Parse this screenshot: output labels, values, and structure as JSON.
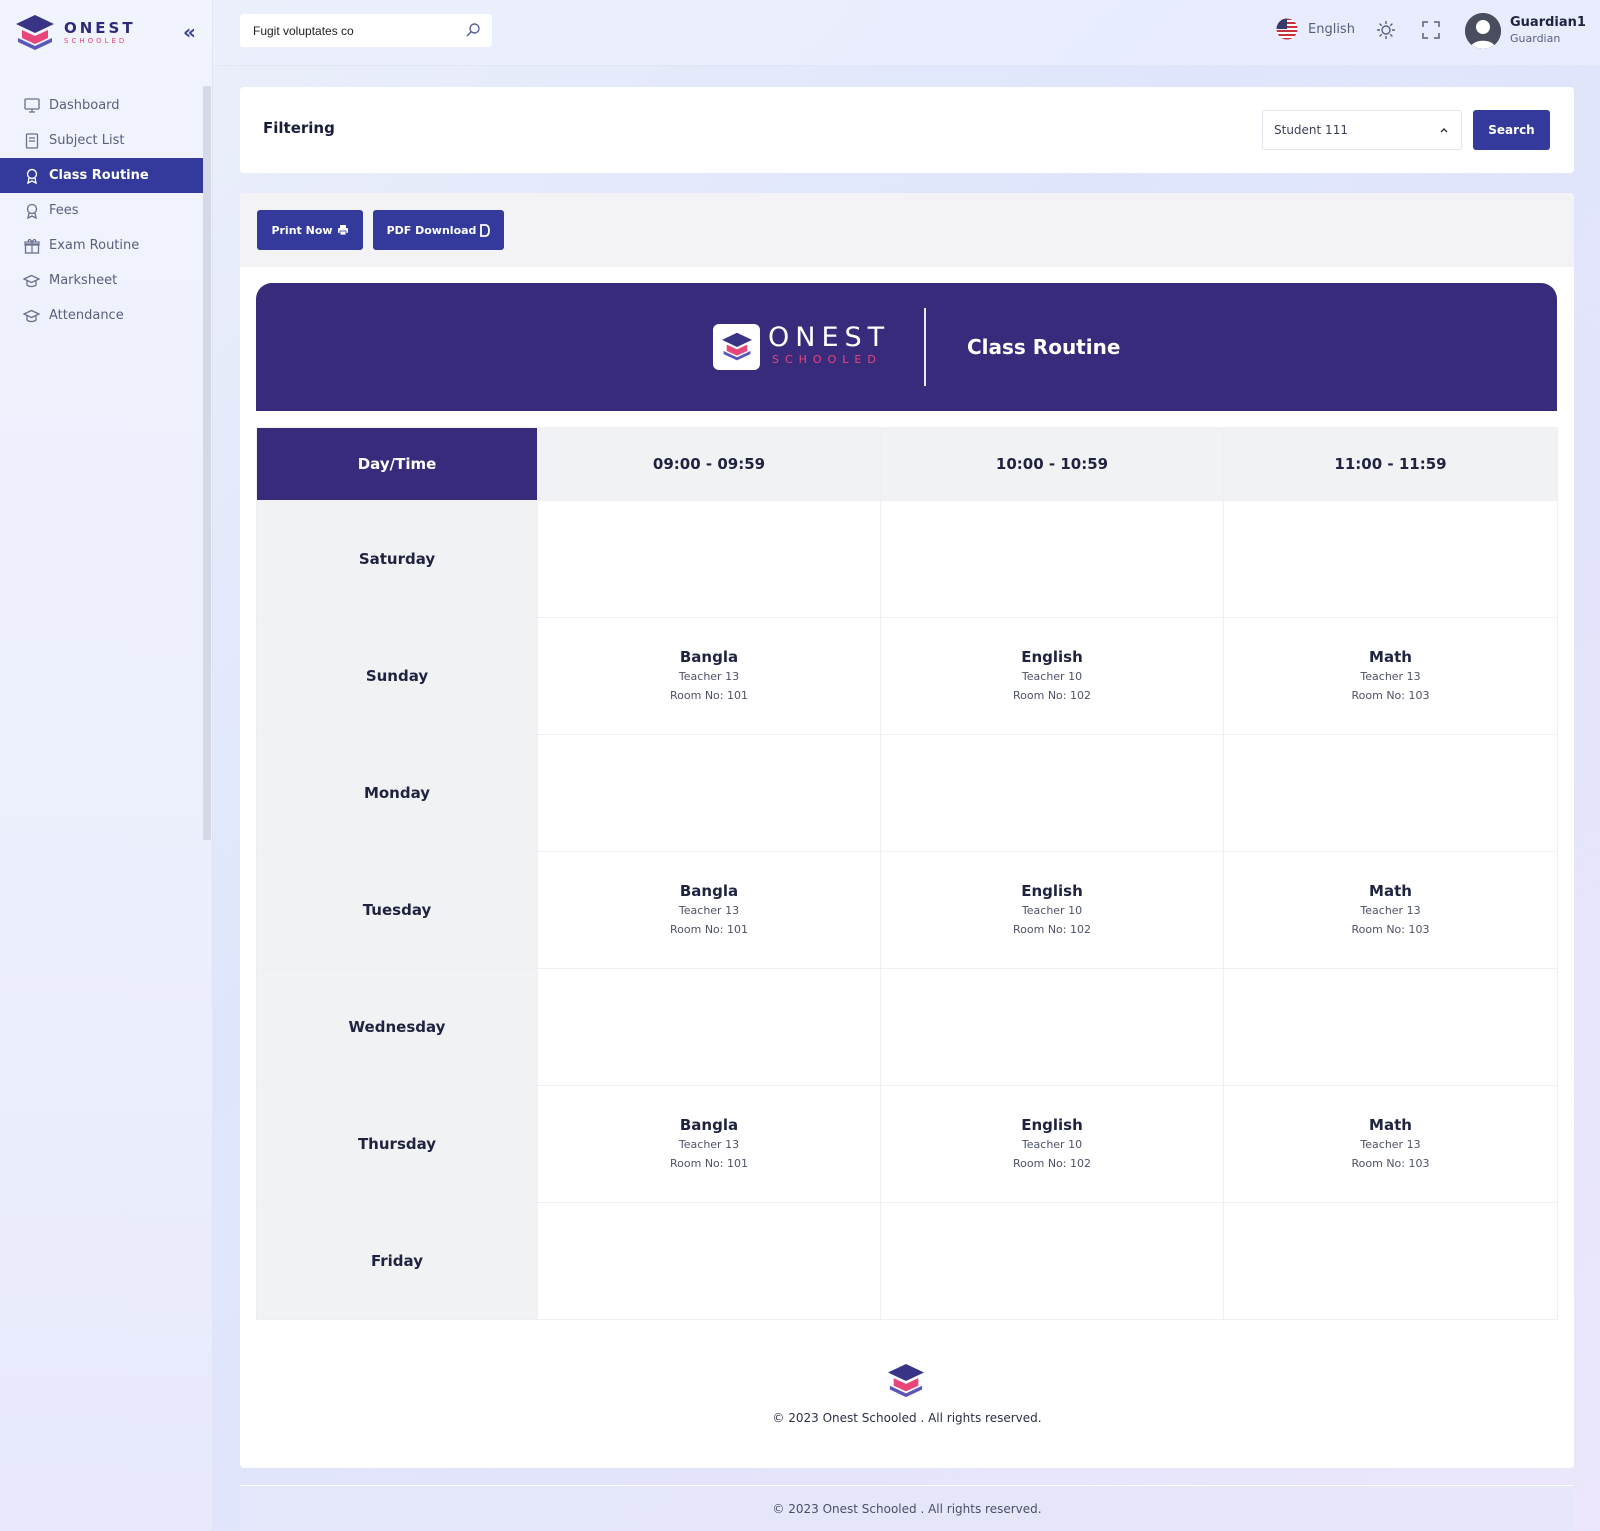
{
  "brand": {
    "name": "ONEST",
    "sub": "SCHOOLED"
  },
  "sidebar": {
    "items": [
      {
        "label": "Dashboard",
        "icon": "monitor-icon"
      },
      {
        "label": "Subject List",
        "icon": "book-icon"
      },
      {
        "label": "Class Routine",
        "icon": "award-icon",
        "active": true
      },
      {
        "label": "Fees",
        "icon": "award-icon"
      },
      {
        "label": "Exam Routine",
        "icon": "gift-icon"
      },
      {
        "label": "Marksheet",
        "icon": "graduation-cap-icon"
      },
      {
        "label": "Attendance",
        "icon": "graduation-cap-icon"
      }
    ]
  },
  "header": {
    "search_value": "Fugit voluptates co",
    "language": "English",
    "user_name": "Guardian1",
    "user_role": "Guardian"
  },
  "filter": {
    "title": "Filtering",
    "student_selected": "Student 111",
    "search_label": "Search"
  },
  "actions": {
    "print_label": "Print Now",
    "pdf_label": "PDF Download"
  },
  "routine": {
    "banner_title": "Class Routine",
    "corner_label": "Day/Time",
    "time_slots": [
      "09:00 - 09:59",
      "10:00 - 10:59",
      "11:00 - 11:59"
    ],
    "days": [
      {
        "day": "Saturday",
        "slots": [
          null,
          null,
          null
        ]
      },
      {
        "day": "Sunday",
        "slots": [
          {
            "subject": "Bangla",
            "teacher": "Teacher 13",
            "room": "Room No: 101"
          },
          {
            "subject": "English",
            "teacher": "Teacher 10",
            "room": "Room No: 102"
          },
          {
            "subject": "Math",
            "teacher": "Teacher 13",
            "room": "Room No: 103"
          }
        ]
      },
      {
        "day": "Monday",
        "slots": [
          null,
          null,
          null
        ]
      },
      {
        "day": "Tuesday",
        "slots": [
          {
            "subject": "Bangla",
            "teacher": "Teacher 13",
            "room": "Room No: 101"
          },
          {
            "subject": "English",
            "teacher": "Teacher 10",
            "room": "Room No: 102"
          },
          {
            "subject": "Math",
            "teacher": "Teacher 13",
            "room": "Room No: 103"
          }
        ]
      },
      {
        "day": "Wednesday",
        "slots": [
          null,
          null,
          null
        ]
      },
      {
        "day": "Thursday",
        "slots": [
          {
            "subject": "Bangla",
            "teacher": "Teacher 13",
            "room": "Room No: 101"
          },
          {
            "subject": "English",
            "teacher": "Teacher 10",
            "room": "Room No: 102"
          },
          {
            "subject": "Math",
            "teacher": "Teacher 13",
            "room": "Room No: 103"
          }
        ]
      },
      {
        "day": "Friday",
        "slots": [
          null,
          null,
          null
        ]
      }
    ],
    "footer_text": "© 2023 Onest Schooled . All rights reserved."
  },
  "page_footer": "© 2023 Onest Schooled . All rights reserved.",
  "colors": {
    "primary": "#333a9b",
    "banner": "#392b7b",
    "accent": "#e8457a"
  }
}
